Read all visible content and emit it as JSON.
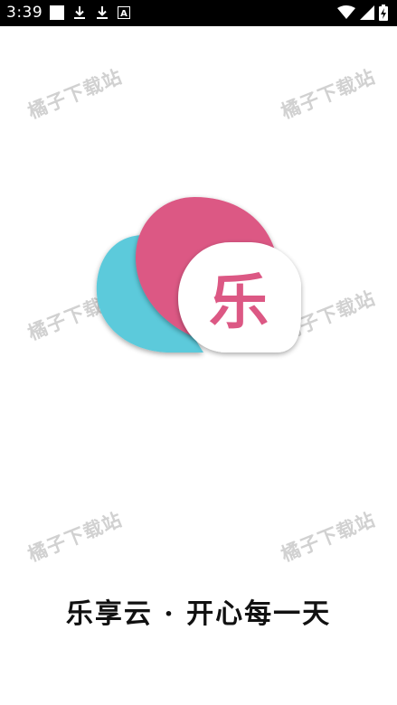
{
  "status_bar": {
    "time": "3:39",
    "left_icons": [
      "white-square-icon",
      "download-icon",
      "download-icon",
      "text-a-icon"
    ],
    "right_icons": [
      "wifi-icon",
      "signal-icon",
      "battery-charging-icon"
    ],
    "text_a_glyph": "A"
  },
  "splash": {
    "logo_char": "乐",
    "slogan": "乐享云 · 开心每一天",
    "colors": {
      "pink": "#dc5884",
      "cyan": "#5ccadb",
      "white_bubble": "#ffffff"
    }
  },
  "watermarks": [
    "橘子下载站",
    "橘子下载站",
    "橘子下载站",
    "橘子下载站",
    "橘子下载站",
    "橘子下载站"
  ]
}
